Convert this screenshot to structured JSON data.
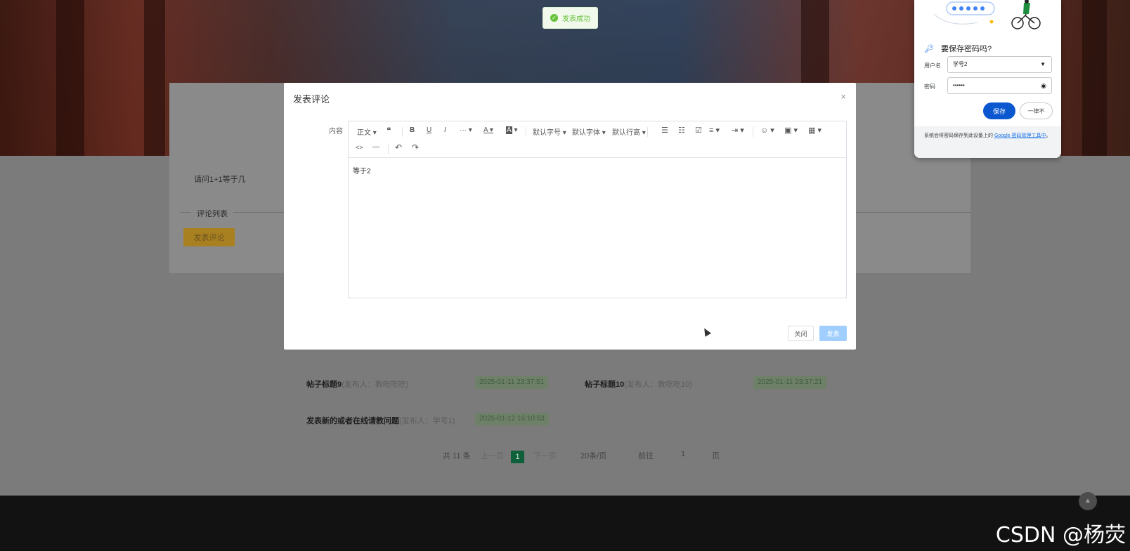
{
  "toast": {
    "message": "发表成功"
  },
  "dialog": {
    "title": "发表评论",
    "close_icon": "×",
    "field_label": "内容",
    "editor_content": "等于2",
    "toolbar": {
      "paragraph": "正文",
      "quote": "❝",
      "bold": "B",
      "underline": "U",
      "italic": "I",
      "more": "···",
      "font_color": "A",
      "bg_color": "A",
      "font_size": "默认字号",
      "font_family": "默认字体",
      "line_height": "默认行高",
      "bullet_list": "☰",
      "numbered_list": "☷",
      "todo": "☑",
      "align": "≡",
      "indent": "⇥",
      "emoji": "☺",
      "image": "▣",
      "table": "▦",
      "code": "<>",
      "divider": "—",
      "undo": "↶",
      "redo": "↷"
    },
    "close_button": "关闭",
    "publish_button": "发表"
  },
  "page": {
    "question": "请问1+1等于几",
    "comment_list_label": "评论列表",
    "publish_comment_button": "发表评论",
    "posts": [
      {
        "title": "帖子标题9",
        "meta": "(发布人：敦吃吃吃)",
        "date": "2025-01-11 23:37:51"
      },
      {
        "title": "帖子标题10",
        "meta": "(发布人：敦吃吃10)",
        "date": "2025-01-11 23:37:21"
      },
      {
        "title": "发表新的或者在线请教问题",
        "meta": "(发布人：学号1)",
        "date": "2025-01-12 16:10:53"
      }
    ],
    "pagination": {
      "total": "共 11 条",
      "prev": "上一页",
      "current": "1",
      "next": "下一页",
      "per_page": "20条/页",
      "goto": "前往",
      "goto_value": "1",
      "page_unit": "页"
    },
    "back_top": "▲"
  },
  "password_popup": {
    "title": "要保存密码吗?",
    "username_label": "用户名",
    "username_value": "学号2",
    "password_label": "密码",
    "password_value": "••••••",
    "save_button": "保存",
    "never_button": "一律不",
    "footer_text": "系统会将密码保存到此设备上的",
    "footer_link": "Google 密码管理工具中",
    "footer_end": "。"
  },
  "watermark": "CSDN @杨荧",
  "colors": {
    "primary": "#409eff",
    "primary_disabled": "#a0cfff",
    "success": "#67c23a",
    "google_blue": "#0b57d0"
  }
}
